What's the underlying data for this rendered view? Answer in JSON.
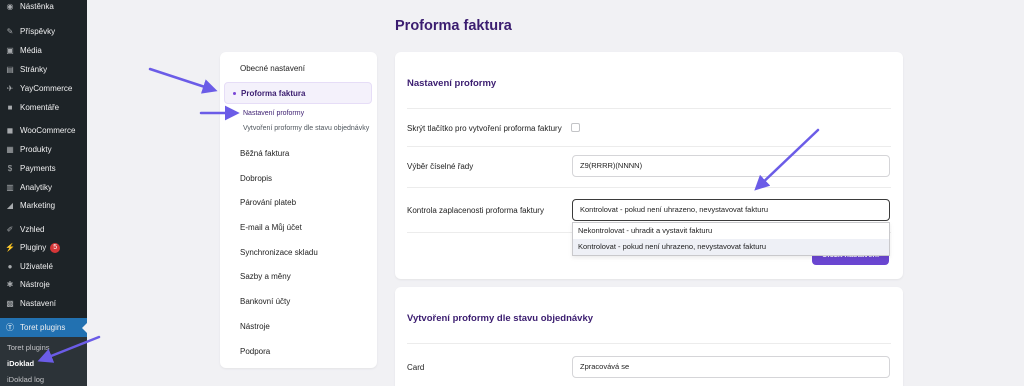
{
  "sidebar": {
    "items": [
      {
        "label": "Nástěnka",
        "icon": "dashboard-icon"
      },
      {
        "label": "Příspěvky",
        "icon": "pin-icon"
      },
      {
        "label": "Média",
        "icon": "media-icon"
      },
      {
        "label": "Stránky",
        "icon": "pages-icon"
      },
      {
        "label": "YayCommerce",
        "icon": "yay-icon"
      },
      {
        "label": "Komentáře",
        "icon": "comments-icon"
      },
      {
        "label": "WooCommerce",
        "icon": "woo-icon"
      },
      {
        "label": "Produkty",
        "icon": "products-icon"
      },
      {
        "label": "Payments",
        "icon": "payments-icon"
      },
      {
        "label": "Analytiky",
        "icon": "analytics-icon"
      },
      {
        "label": "Marketing",
        "icon": "marketing-icon"
      },
      {
        "label": "Vzhled",
        "icon": "brush-icon"
      },
      {
        "label": "Pluginy",
        "icon": "plugin-icon",
        "badge": "5"
      },
      {
        "label": "Uživatelé",
        "icon": "users-icon"
      },
      {
        "label": "Nástroje",
        "icon": "wrench-icon"
      },
      {
        "label": "Nastavení",
        "icon": "settings-icon"
      },
      {
        "label": "Toret plugins",
        "icon": "toret-icon"
      }
    ],
    "submenu": [
      "Toret plugins",
      "iDoklad",
      "iDoklad log"
    ]
  },
  "page": {
    "title": "Proforma faktura"
  },
  "nav": {
    "items": [
      "Obecné nastavení",
      "Proforma faktura",
      "Běžná faktura",
      "Dobropis",
      "Párování plateb",
      "E-mail a Můj účet",
      "Synchronizace skladu",
      "Sazby a měny",
      "Bankovní účty",
      "Nástroje",
      "Podpora"
    ],
    "subitems": [
      "Nastavení proformy",
      "Vytvoření proformy dle stavu objednávky"
    ]
  },
  "settings": {
    "title": "Nastavení proformy",
    "hide_button_label": "Skrýt tlačítko pro vytvoření proforma faktury",
    "number_series_label": "Výběr číselné řady",
    "number_series_value": "Z9(RRRR)(NNNN)",
    "payment_check_label": "Kontrola zaplacenosti proforma faktury",
    "payment_check_value": "Kontrolovat - pokud není uhrazeno, nevystavovat fakturu",
    "options": [
      "Nekontrolovat - uhradit a vystavit fakturu",
      "Kontrolovat - pokud není uhrazeno, nevystavovat fakturu"
    ],
    "save_label": "Uložit nastavení"
  },
  "by_status": {
    "title": "Vytvoření proformy dle stavu objednávky",
    "card_label": "Card",
    "card_value": "Zpracovává se"
  },
  "colors": {
    "accent": "#6a46d1",
    "title": "#3b1d70",
    "arrow": "#6b5ce7",
    "sidebar": "#1d2327",
    "active": "#2271b1"
  }
}
